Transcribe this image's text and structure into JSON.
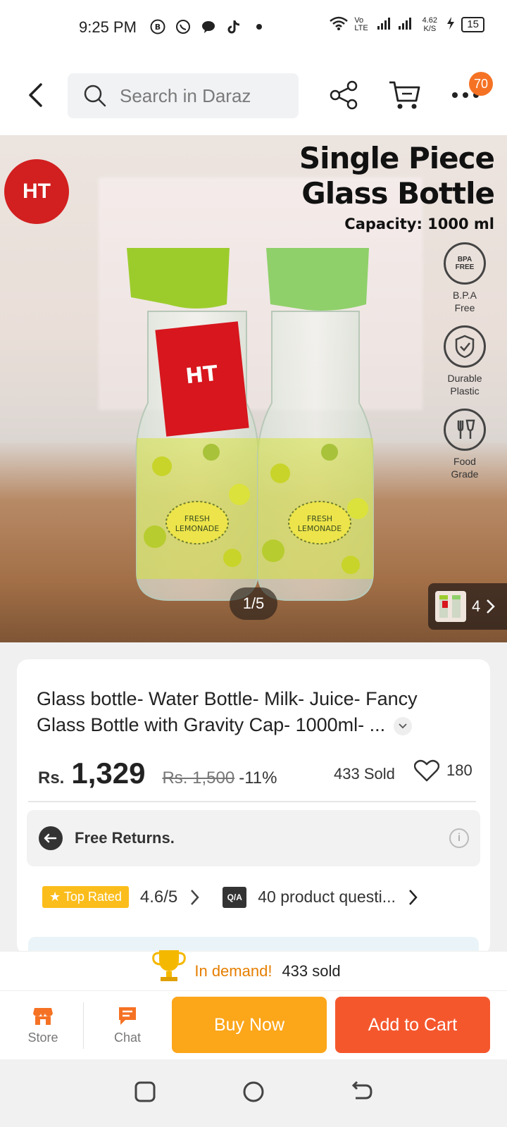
{
  "status_bar": {
    "time": "9:25 PM",
    "network_label": "Vo LTE",
    "speed": "4.62 K/S",
    "battery": "15"
  },
  "search": {
    "placeholder": "Search in Daraz"
  },
  "header": {
    "more_badge": "70"
  },
  "product_image": {
    "headline_line1": "Single Piece",
    "headline_line2": "Glass Bottle",
    "capacity": "Capacity: 1000 ml",
    "features": [
      {
        "icon": "bpa-free-icon",
        "badge": "BPA FREE",
        "label_l1": "B.P.A",
        "label_l2": "Free"
      },
      {
        "icon": "shield-check-icon",
        "label_l1": "Durable",
        "label_l2": "Plastic"
      },
      {
        "icon": "fork-glass-icon",
        "label_l1": "Food",
        "label_l2": "Grade"
      }
    ],
    "bottle_label": "FRESH LEMONADE",
    "pager": "1/5",
    "more_count": "4"
  },
  "product": {
    "title": "Glass bottle- Water Bottle- Milk- Juice- Fancy Glass Bottle with Gravity Cap- 1000ml- ...",
    "currency": "Rs.",
    "price": "1,329",
    "old_price": "Rs. 1,500",
    "discount": "-11%",
    "sold": "433 Sold",
    "favorites": "180",
    "returns": "Free Returns.",
    "top_rated": "Top Rated",
    "rating": "4.6/5",
    "qa_badge": "Q/A",
    "questions": "40 product questi..."
  },
  "demand": {
    "label": "In demand!",
    "count": "433 sold"
  },
  "actions": {
    "store": "Store",
    "chat": "Chat",
    "buy_now": "Buy Now",
    "add_to_cart": "Add to Cart"
  },
  "colors": {
    "accent": "#f57224",
    "buy_now": "#fca61a",
    "add_to_cart": "#f5572d",
    "top_rated": "#fbbd1b",
    "demand": "#e67e00"
  }
}
